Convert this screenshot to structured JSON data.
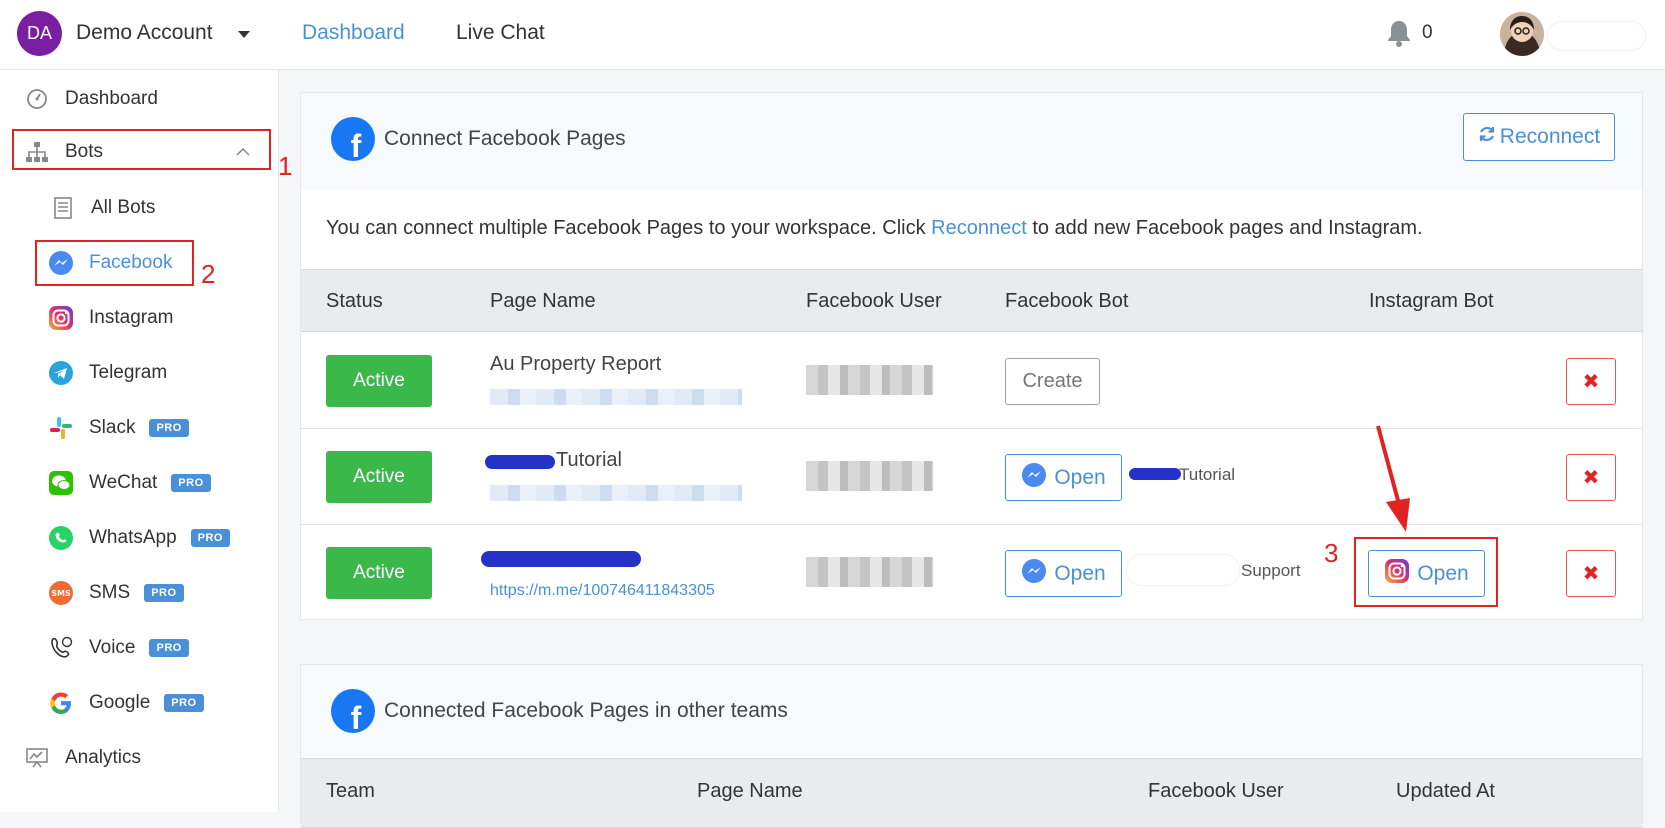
{
  "topbar": {
    "avatar_initials": "DA",
    "account_name": "Demo Account",
    "nav": [
      "Dashboard",
      "Live Chat"
    ],
    "notifications": "0"
  },
  "sidebar": {
    "dashboard": "Dashboard",
    "bots": "Bots",
    "all_bots": "All Bots",
    "facebook": "Facebook",
    "instagram": "Instagram",
    "telegram": "Telegram",
    "slack": "Slack",
    "wechat": "WeChat",
    "whatsapp": "WhatsApp",
    "sms": "SMS",
    "voice": "Voice",
    "google": "Google",
    "analytics": "Analytics",
    "pro_badge": "PRO"
  },
  "annotations": [
    "1",
    "2",
    "3"
  ],
  "connect_card": {
    "title": "Connect Facebook Pages",
    "reconnect_button": "Reconnect",
    "desc_before": "You can connect multiple Facebook Pages to your workspace. Click ",
    "desc_link": "Reconnect",
    "desc_after": " to add new Facebook pages and Instagram.",
    "columns": [
      "Status",
      "Page Name",
      "Facebook User",
      "Facebook Bot",
      "Instagram Bot"
    ],
    "rows": [
      {
        "status": "Active",
        "page_name": "Au Property Report",
        "page_link": "",
        "facebook_bot": "Create",
        "facebook_bot_name": "",
        "instagram_bot": ""
      },
      {
        "status": "Active",
        "page_name": "Tutorial",
        "page_link": "",
        "facebook_bot": "Open",
        "facebook_bot_name": "Tutorial",
        "instagram_bot": ""
      },
      {
        "status": "Active",
        "page_name": "",
        "page_link": "https://m.me/100746411843305",
        "facebook_bot": "Open",
        "facebook_bot_name": "Support",
        "instagram_bot": "Open"
      }
    ]
  },
  "other_teams_card": {
    "title": "Connected Facebook Pages in other teams",
    "columns": [
      "Team",
      "Page Name",
      "Facebook User",
      "Updated At"
    ]
  },
  "colors": {
    "accent": "#4a90d9",
    "active_green": "#3ab94a",
    "annotation_red": "#e32222",
    "avatar_purple": "#7a1fa2"
  }
}
